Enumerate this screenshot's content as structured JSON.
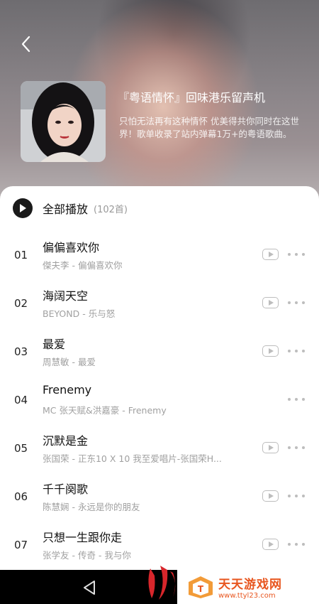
{
  "header": {
    "title": "『粤语情怀』回味港乐留声机",
    "description": "只怕无法再有这种情怀 优美得共你同时在这世界！歌单收录了站内弹幕1万+的粤语歌曲。"
  },
  "playlist": {
    "play_all_label": "全部播放",
    "count_label": "(102首)"
  },
  "songs": [
    {
      "num": "01",
      "title": "偏偏喜欢你",
      "subtitle": "傑夫李 - 偏偏喜欢你",
      "has_mv": true
    },
    {
      "num": "02",
      "title": "海阔天空",
      "subtitle": "BEYOND - 乐与怒",
      "has_mv": true
    },
    {
      "num": "03",
      "title": "最爱",
      "subtitle": "周慧敏 - 最爱",
      "has_mv": true
    },
    {
      "num": "04",
      "title": "Frenemy",
      "subtitle": "MC 张天赋&洪嘉豪 - Frenemy",
      "has_mv": false
    },
    {
      "num": "05",
      "title": "沉默是金",
      "subtitle": "张国荣 - 正东10 X 10 我至爱唱片-张国荣H...",
      "has_mv": true
    },
    {
      "num": "06",
      "title": "千千阕歌",
      "subtitle": "陈慧娴 - 永远是你的朋友",
      "has_mv": true
    },
    {
      "num": "07",
      "title": "只想一生跟你走",
      "subtitle": "张学友 - 传奇 - 我与你",
      "has_mv": true
    }
  ],
  "watermark": {
    "title": "天天游戏网",
    "url": "www.ttyl23.com"
  },
  "icons": {
    "back": "chevron-left-icon",
    "play": "play-circle-icon",
    "mv": "video-play-icon",
    "more": "more-dots-icon",
    "nav_back": "triangle-back-icon"
  }
}
